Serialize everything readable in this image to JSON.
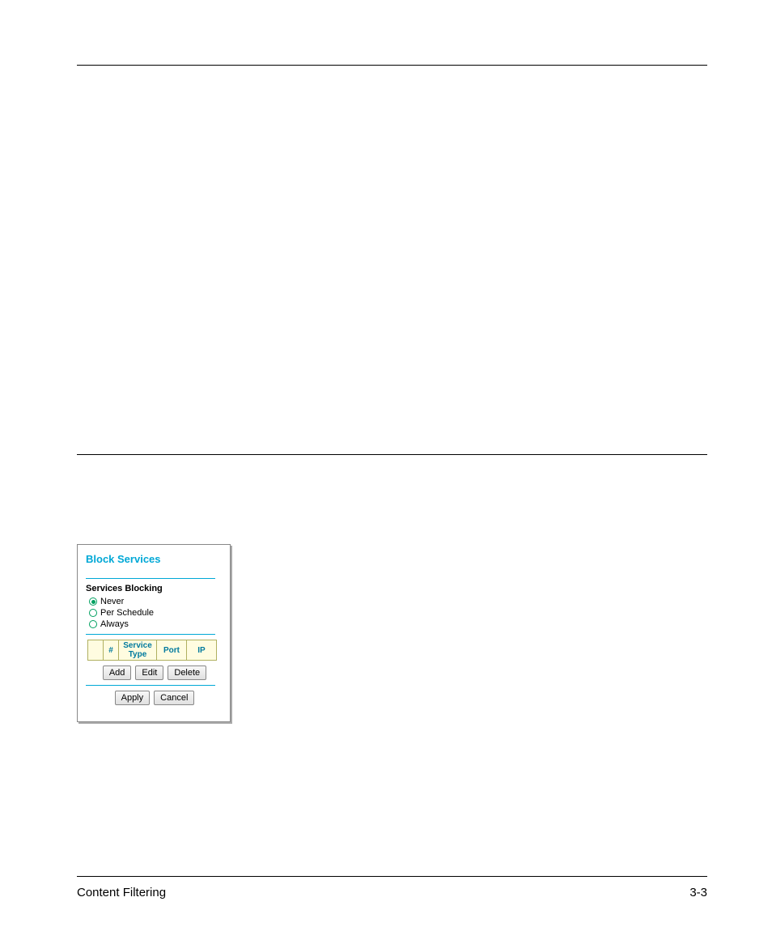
{
  "panel": {
    "title": "Block Services",
    "section_label": "Services Blocking",
    "options": {
      "never": "Never",
      "per_schedule": "Per Schedule",
      "always": "Always"
    },
    "table_headers": {
      "sel": "",
      "num": "#",
      "service_type": "Service Type",
      "port": "Port",
      "ip": "IP"
    },
    "buttons": {
      "add": "Add",
      "edit": "Edit",
      "delete": "Delete",
      "apply": "Apply",
      "cancel": "Cancel"
    }
  },
  "footer": {
    "section": "Content Filtering",
    "page": "3-3"
  }
}
